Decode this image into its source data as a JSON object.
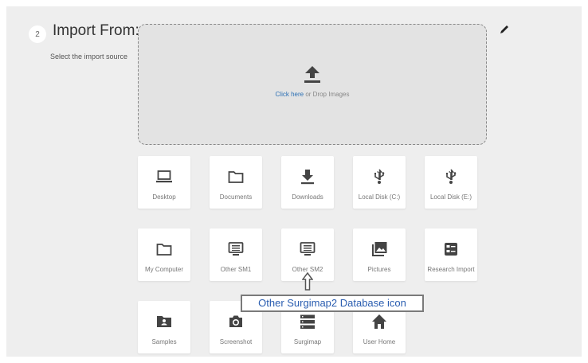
{
  "step": {
    "number": "2",
    "title": "Import From:",
    "subtitle": "Select the import source"
  },
  "dropzone": {
    "link": "Click here",
    "text": " or Drop Images"
  },
  "tiles": [
    {
      "label": "Desktop",
      "icon": "laptop-icon"
    },
    {
      "label": "Documents",
      "icon": "folder-icon"
    },
    {
      "label": "Downloads",
      "icon": "download-icon"
    },
    {
      "label": "Local Disk (C:)",
      "icon": "usb-icon"
    },
    {
      "label": "Local Disk (E:)",
      "icon": "usb-icon"
    },
    {
      "label": "My Computer",
      "icon": "folder-icon"
    },
    {
      "label": "Other SM1",
      "icon": "database-monitor-icon"
    },
    {
      "label": "Other SM2",
      "icon": "database-monitor-icon"
    },
    {
      "label": "Pictures",
      "icon": "pictures-icon"
    },
    {
      "label": "Research Import",
      "icon": "research-import-icon"
    },
    {
      "label": "Samples",
      "icon": "user-folder-icon"
    },
    {
      "label": "Screenshot",
      "icon": "camera-icon"
    },
    {
      "label": "Surgimap",
      "icon": "list-icon"
    },
    {
      "label": "User Home",
      "icon": "home-icon"
    }
  ],
  "tooltip": {
    "text": "Other Surgimap2 Database icon"
  },
  "colors": {
    "panel": "#eeeeee",
    "icon": "#444444",
    "link": "#2a6fb4",
    "tooltip_text": "#2a5db0"
  }
}
